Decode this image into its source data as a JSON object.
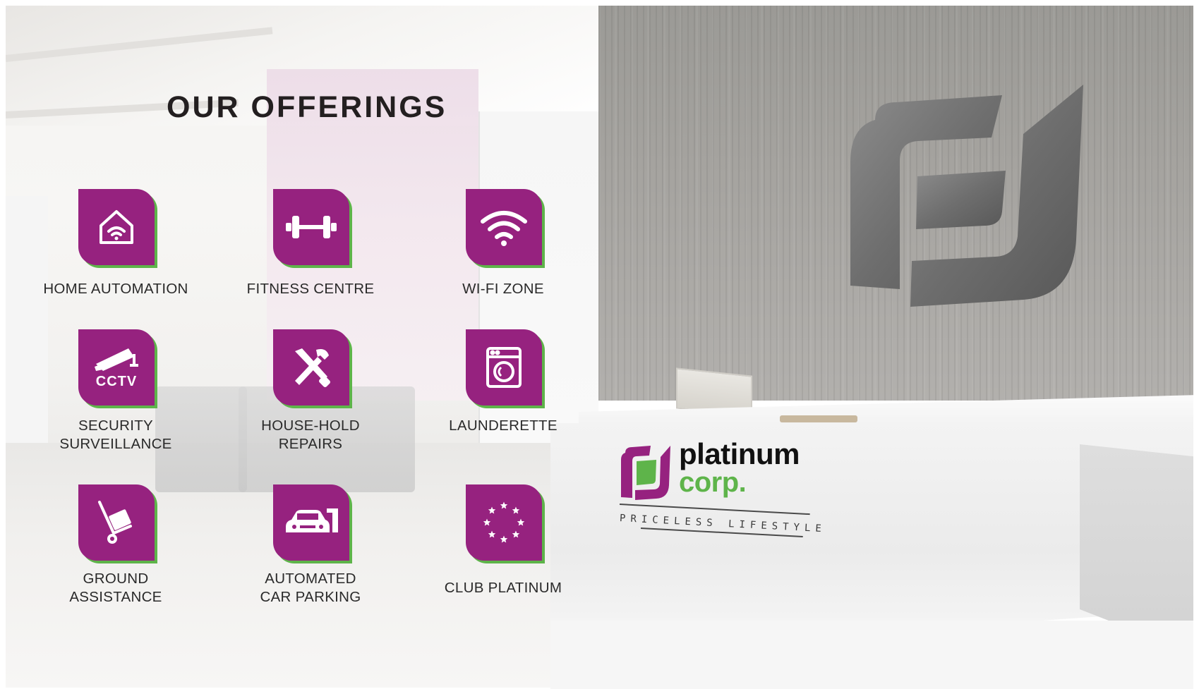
{
  "heading": "OUR OFFERINGS",
  "offerings": [
    {
      "line1": "HOME AUTOMATION",
      "line2": "",
      "icon": "smart-home-icon"
    },
    {
      "line1": "FITNESS CENTRE",
      "line2": "",
      "icon": "dumbbell-icon"
    },
    {
      "line1": "WI-FI ZONE",
      "line2": "",
      "icon": "wifi-icon"
    },
    {
      "line1": "SECURITY",
      "line2": "SURVEILLANCE",
      "icon": "cctv-camera-icon",
      "icon_text": "CCTV"
    },
    {
      "line1": "HOUSE-HOLD",
      "line2": "REPAIRS",
      "icon": "tools-icon"
    },
    {
      "line1": "LAUNDERETTE",
      "line2": "",
      "icon": "washing-machine-icon"
    },
    {
      "line1": "GROUND",
      "line2": "ASSISTANCE",
      "icon": "luggage-trolley-icon"
    },
    {
      "line1": "AUTOMATED",
      "line2": "CAR PARKING",
      "icon": "car-parking-icon"
    },
    {
      "line1": "CLUB PLATINUM",
      "line2": "",
      "icon": "star-circle-icon"
    }
  ],
  "brand": {
    "name": "platinum",
    "suffix": "corp.",
    "tagline": "PRICELESS LIFESTYLE"
  },
  "colors": {
    "tile_purple": "#96227f",
    "tile_accent_green": "#5eb44a",
    "heading_text": "#231f20"
  }
}
